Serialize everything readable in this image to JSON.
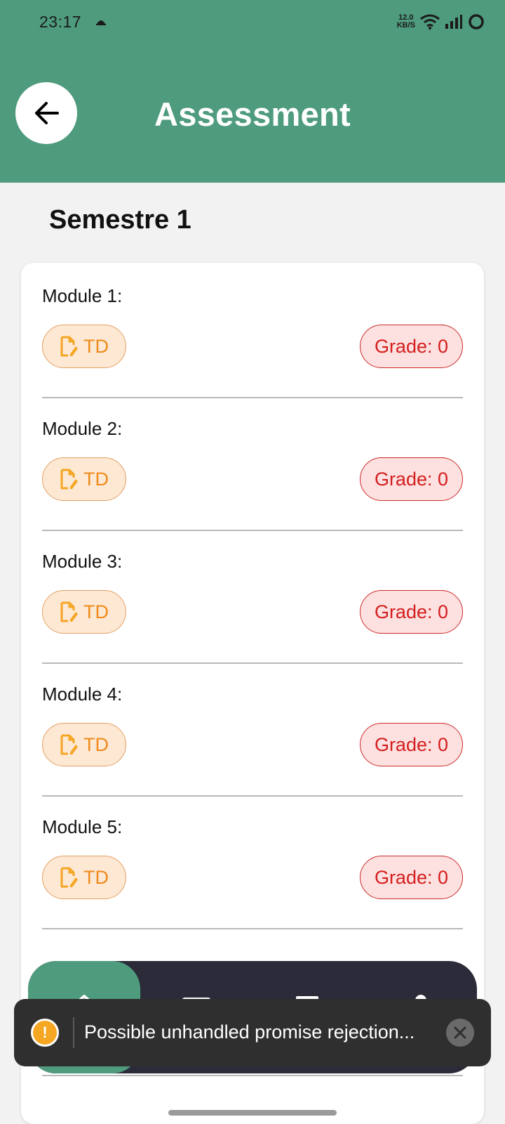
{
  "status_bar": {
    "time": "23:17",
    "network_speed_value": "12.0",
    "network_speed_unit": "KB/S"
  },
  "header": {
    "title": "Assessment",
    "back_icon": "arrow-left-icon"
  },
  "semester": {
    "title": "Semestre 1",
    "modules": [
      {
        "title": "Module 1:",
        "td_label": "TD",
        "grade_label": "Grade: 0"
      },
      {
        "title": "Module 2:",
        "td_label": "TD",
        "grade_label": "Grade: 0"
      },
      {
        "title": "Module 3:",
        "td_label": "TD",
        "grade_label": "Grade: 0"
      },
      {
        "title": "Module 4:",
        "td_label": "TD",
        "grade_label": "Grade: 0"
      },
      {
        "title": "Module 5:",
        "td_label": "TD",
        "grade_label": "Grade: 0"
      }
    ]
  },
  "tab_bar": {
    "tabs": [
      {
        "icon": "home-icon",
        "active": true
      },
      {
        "icon": "mail-icon",
        "active": false
      },
      {
        "icon": "calendar-icon",
        "active": false
      },
      {
        "icon": "profile-icon",
        "active": false
      }
    ]
  },
  "toast": {
    "icon": "warning-icon",
    "message": "Possible unhandled promise rejection..."
  },
  "colors": {
    "brand_green": "#4e9b7d",
    "td_orange": "#f08a1a",
    "grade_red": "#d41e1e",
    "tab_bar_dark": "#2b2b39"
  }
}
